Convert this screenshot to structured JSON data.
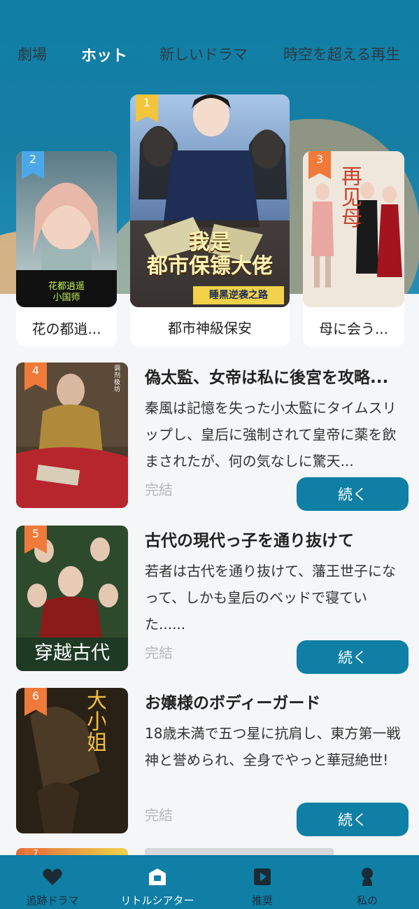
{
  "tabs": [
    "劇場",
    "ホット",
    "新しいドラマ",
    "時空を超える再生"
  ],
  "top_cards": [
    {
      "rank": "2",
      "title": "花の都逍...",
      "poster_text": [
        "花都逍遥",
        "小国师"
      ]
    },
    {
      "rank": "1",
      "title": "都市神級保安",
      "poster_text": [
        "我是",
        "都市保镖大佬",
        "睡黑逆袭之路"
      ]
    },
    {
      "rank": "3",
      "title": "母に会う...",
      "poster_text": [
        "再见母"
      ]
    }
  ],
  "list": [
    {
      "rank": "4",
      "title": "偽太監、女帝は私に後宮を攻略...",
      "desc": "秦風は記憶を失った小太監にタイムスリップし、皇后に強制されて皇帝に薬を飲まされたが、何の気なしに驚天...",
      "status": "完結",
      "button": "続く",
      "poster_text": "调剂极坊"
    },
    {
      "rank": "5",
      "title": "古代の現代っ子を通り抜けて",
      "desc": "若者は古代を通り抜けて、藩王世子になって、しかも皇后のベッドで寝ていた......",
      "status": "完結",
      "button": "続く",
      "poster_text": "穿越古代"
    },
    {
      "rank": "6",
      "title": "お嬢様のボディーガード",
      "desc": "18歳未満で五つ星に抗肩し、東方第一戦神と誉められ、全身でやっと華冠絶世!",
      "status": "完結",
      "button": "続く",
      "poster_text": "大小姐的贴身保镖"
    }
  ],
  "next_rank": "7",
  "nav": [
    {
      "label": "追跡ドラマ",
      "icon": "heart-icon"
    },
    {
      "label": "リトルシアター",
      "icon": "theater-icon"
    },
    {
      "label": "推奨",
      "icon": "play-icon"
    },
    {
      "label": "私の",
      "icon": "person-icon"
    }
  ],
  "colors": {
    "primary": "#0f7fa6",
    "gold": "#f3c53c",
    "blue": "#4aa8e8",
    "orange": "#ef7a3a"
  }
}
